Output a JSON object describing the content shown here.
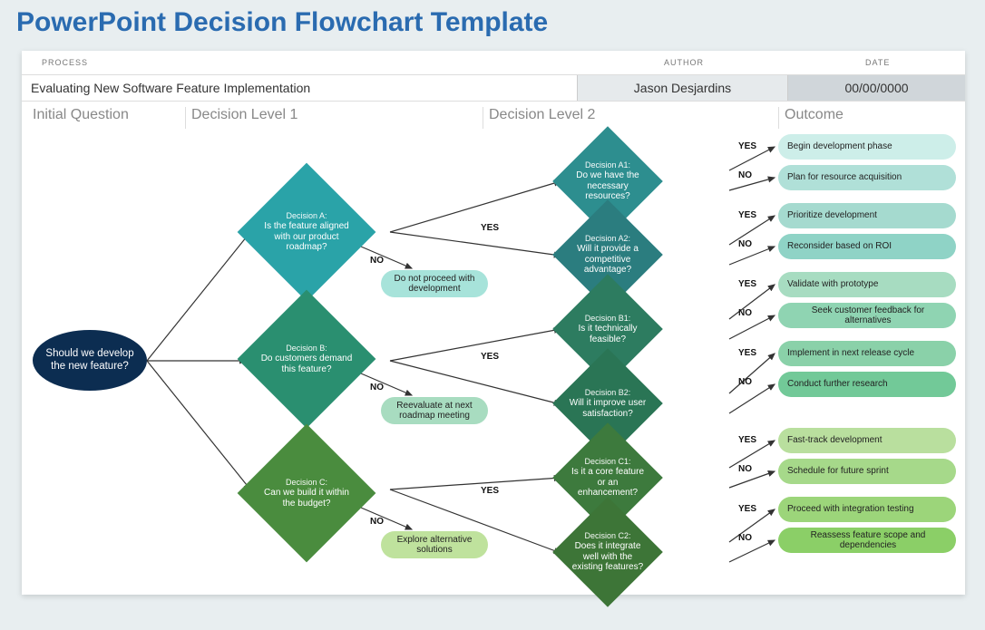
{
  "title": "PowerPoint Decision Flowchart Template",
  "header": {
    "processLabel": "PROCESS",
    "authorLabel": "AUTHOR",
    "dateLabel": "DATE",
    "process": "Evaluating New Software Feature Implementation",
    "author": "Jason Desjardins",
    "date": "00/00/0000"
  },
  "columns": {
    "c0": "Initial Question",
    "c1": "Decision Level 1",
    "c2": "Decision Level 2",
    "c3": "Outcome"
  },
  "start": "Should we develop the new feature?",
  "level1": {
    "a": {
      "title": "Decision A:",
      "text": "Is the feature aligned with our product roadmap?"
    },
    "b": {
      "title": "Decision B:",
      "text": "Do customers demand this feature?"
    },
    "c": {
      "title": "Decision C:",
      "text": "Can we build it within the budget?"
    }
  },
  "level1_no": {
    "a": "Do not proceed with development",
    "b": "Reevaluate at next roadmap meeting",
    "c": "Explore alternative solutions"
  },
  "level2": {
    "a1": {
      "title": "Decision A1:",
      "text": "Do we have the necessary resources?"
    },
    "a2": {
      "title": "Decision A2:",
      "text": "Will it provide a competitive advantage?"
    },
    "b1": {
      "title": "Decision B1:",
      "text": "Is it technically feasible?"
    },
    "b2": {
      "title": "Decision B2:",
      "text": "Will it improve user satisfaction?"
    },
    "c1": {
      "title": "Decision C1:",
      "text": "Is it a core feature or an enhancement?"
    },
    "c2": {
      "title": "Decision C2:",
      "text": "Does it integrate well with the existing features?"
    }
  },
  "outcomes": {
    "a1y": "Begin development phase",
    "a1n": "Plan for resource acquisition",
    "a2y": "Prioritize development",
    "a2n": "Reconsider based on ROI",
    "b1y": "Validate with prototype",
    "b1n": "Seek customer feedback for alternatives",
    "b2y": "Implement in next release cycle",
    "b2n": "Conduct further research",
    "c1y": "Fast-track development",
    "c1n": "Schedule for future sprint",
    "c2y": "Proceed with integration testing",
    "c2n": "Reassess feature scope and dependencies"
  },
  "labels": {
    "yes": "YES",
    "no": "NO"
  }
}
